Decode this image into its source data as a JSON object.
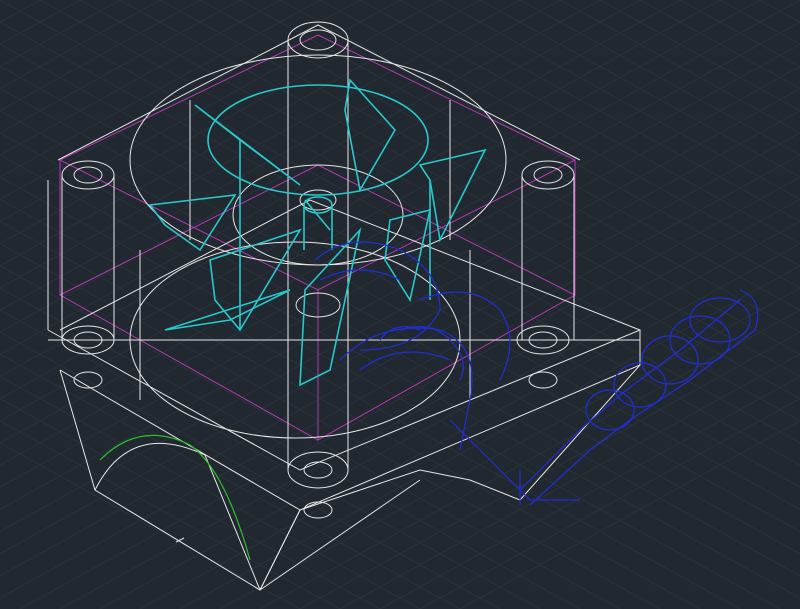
{
  "viewport": {
    "background_color": "#212830",
    "grid_color": "#2a323c",
    "visual_style": "wireframe"
  },
  "layers": [
    {
      "name": "housing",
      "color": "#e6e6e6"
    },
    {
      "name": "impeller",
      "color": "#27c9cc"
    },
    {
      "name": "motor",
      "color": "#1f2fd6"
    },
    {
      "name": "bounding-box",
      "color": "#b43ab0"
    },
    {
      "name": "outlet-arc",
      "color": "#2bbf2b"
    }
  ],
  "cursor": {
    "icon": "crosshair-icon"
  }
}
